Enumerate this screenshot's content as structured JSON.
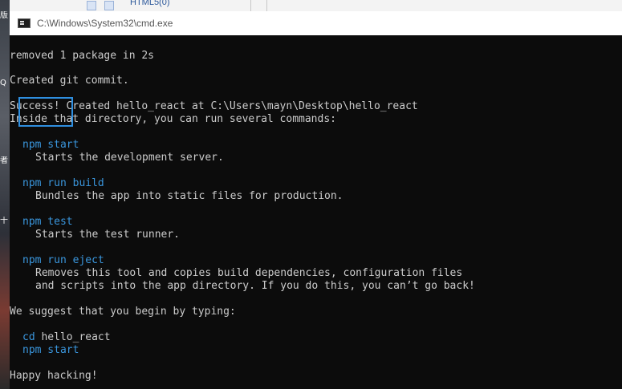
{
  "desktop": {
    "chars": [
      "版",
      "Q",
      "者",
      "十"
    ]
  },
  "background_window": {
    "tab_label": "HTML5(0)"
  },
  "window": {
    "title": "C:\\Windows\\System32\\cmd.exe"
  },
  "console": {
    "lines": [
      "removed 1 package in 2s",
      "Created git commit.",
      "Success! Created hello_react at C:\\Users\\mayn\\Desktop\\hello_react",
      "Inside that directory, you can run several commands:",
      "npm start",
      "Starts the development server.",
      "npm run build",
      "Bundles the app into static files for production.",
      "npm test",
      "Starts the test runner.",
      "npm run eject",
      "Removes this tool and copies build dependencies, configuration files",
      "and scripts into the app directory. If you do this, you can’t go back!",
      "We suggest that you begin by typing:",
      "cd",
      "hello_react",
      "npm start",
      "Happy hacking!"
    ]
  },
  "colors": {
    "console_bg": "#0c0c0c",
    "console_text": "#cccccc",
    "command_blue": "#3a96dd",
    "highlight": "#2f8fe0"
  }
}
